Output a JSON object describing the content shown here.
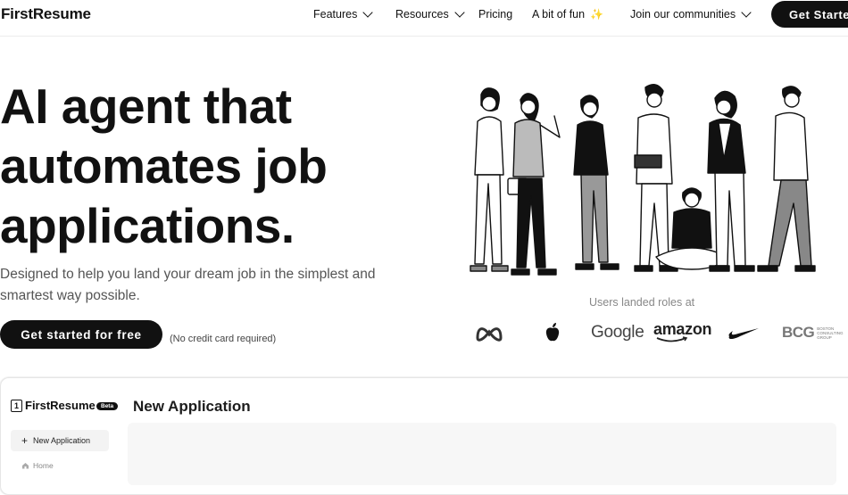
{
  "nav": {
    "logo": "FirstResume",
    "items": [
      {
        "label": "Features",
        "dropdown": true
      },
      {
        "label": "Resources",
        "dropdown": true
      },
      {
        "label": "Pricing",
        "dropdown": false
      },
      {
        "label": "A bit of fun",
        "dropdown": false,
        "icon": "sparkle-icon"
      },
      {
        "label": "Join our communities",
        "dropdown": true
      }
    ],
    "cta": "Get Started"
  },
  "hero": {
    "title_lines": [
      "AI agent that",
      "automates job",
      "applications."
    ],
    "subtitle": "Designed to help you land your dream job in the simplest and smartest way possible.",
    "cta": "Get started for free",
    "note": "(No credit card required)"
  },
  "social_proof": {
    "label": "Users landed roles at",
    "brands": [
      "meta-logo",
      "apple-logo",
      "Google",
      "amazon",
      "nike-logo",
      "BCG"
    ],
    "bcg_small_lines": [
      "BOSTON",
      "CONSULTING",
      "GROUP"
    ]
  },
  "app_preview": {
    "logo_digit": "1",
    "logo": "FirstResume",
    "badge": "Beta",
    "title": "New Application",
    "new_button": "New Application",
    "home": "Home"
  },
  "colors": {
    "primary": "#111111",
    "sparkle": "#f5b23a",
    "muted_text": "#555555",
    "panel_border": "#e6e6e6"
  }
}
